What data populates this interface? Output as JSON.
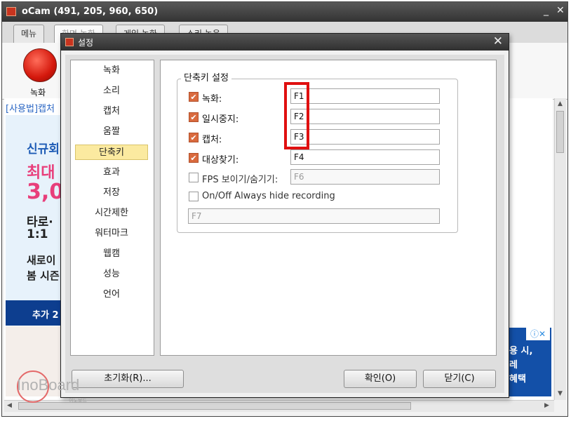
{
  "main": {
    "title": "oCam (491, 205, 960, 650)",
    "minimize": "_",
    "close": "✕",
    "tabs": [
      "메뉴",
      "화면 녹화",
      "게임 녹화",
      "소리 녹음"
    ],
    "record_label": "녹화",
    "help_link": "[사용법]캡처",
    "ad_left_lines": [
      "신규회",
      "최대",
      "3,0",
      "타로·",
      "1:1",
      "새로이",
      "봄 시즌"
    ],
    "ad_band": "추가 2",
    "ad_right_lines": [
      "용 시,",
      "레",
      "혜택"
    ],
    "ad_close": "ⓘ✕"
  },
  "dialog": {
    "title": "설정",
    "close": "✕",
    "categories": [
      "녹화",
      "소리",
      "캡처",
      "움짤",
      "단축키",
      "효과",
      "저장",
      "시간제한",
      "워터마크",
      "웹캠",
      "성능",
      "언어"
    ],
    "selected_category": "단축키",
    "group_title": "단축키 설정",
    "hotkeys": [
      {
        "label": "녹화:",
        "checked": true,
        "value": "F1"
      },
      {
        "label": "일시중지:",
        "checked": true,
        "value": "F2"
      },
      {
        "label": "캡처:",
        "checked": true,
        "value": "F3"
      },
      {
        "label": "대상찾기:",
        "checked": true,
        "value": "F4"
      },
      {
        "label": "FPS 보이기/숨기기:",
        "checked": false,
        "value": "F6"
      }
    ],
    "always_hide_label": "On/Off Always hide recording",
    "always_hide_value": "F7",
    "reset_button": "초기화(R)...",
    "ok_button": "확인(O)",
    "close_button": "닫기(C)"
  },
  "watermark": {
    "text": "InoBoard",
    "sub": "이노보드"
  },
  "colors": {
    "accent_check": "#d96a3e",
    "highlight_box": "#e01010",
    "selected_category": "#fbeaa0"
  }
}
